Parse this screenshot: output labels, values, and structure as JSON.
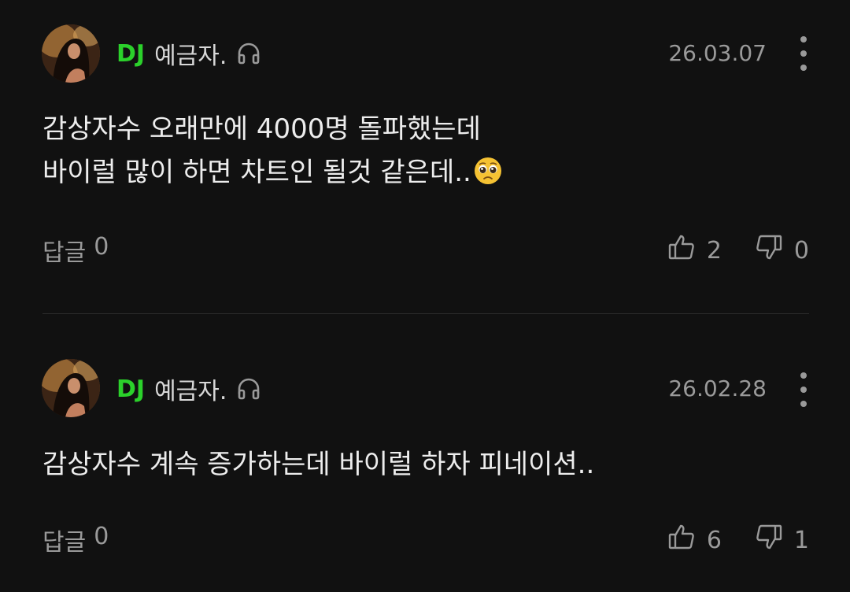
{
  "comments": [
    {
      "badge": "DJ",
      "author": "예금자.",
      "date": "26.03.07",
      "lines": [
        "감상자수 오래만에 4000명 돌파했는데",
        "바이럴 많이 하면 차트인 될것 같은데.."
      ],
      "emoji": "pleading-face-emoji",
      "reply_label": "답글",
      "reply_count": "0",
      "likes": "2",
      "dislikes": "0"
    },
    {
      "badge": "DJ",
      "author": "예금자.",
      "date": "26.02.28",
      "lines": [
        "감상자수 계속 증가하는데 바이럴 하자 피네이션.."
      ],
      "reply_label": "답글",
      "reply_count": "0",
      "likes": "6",
      "dislikes": "1"
    }
  ],
  "icons": {
    "headphone": "headphone-icon",
    "more": "more-vertical-icon",
    "like": "thumbs-up-icon",
    "dislike": "thumbs-down-icon"
  },
  "colors": {
    "background": "#111111",
    "dj_badge": "#2bd12b",
    "muted": "#9a9a9a",
    "text": "#ededed"
  }
}
